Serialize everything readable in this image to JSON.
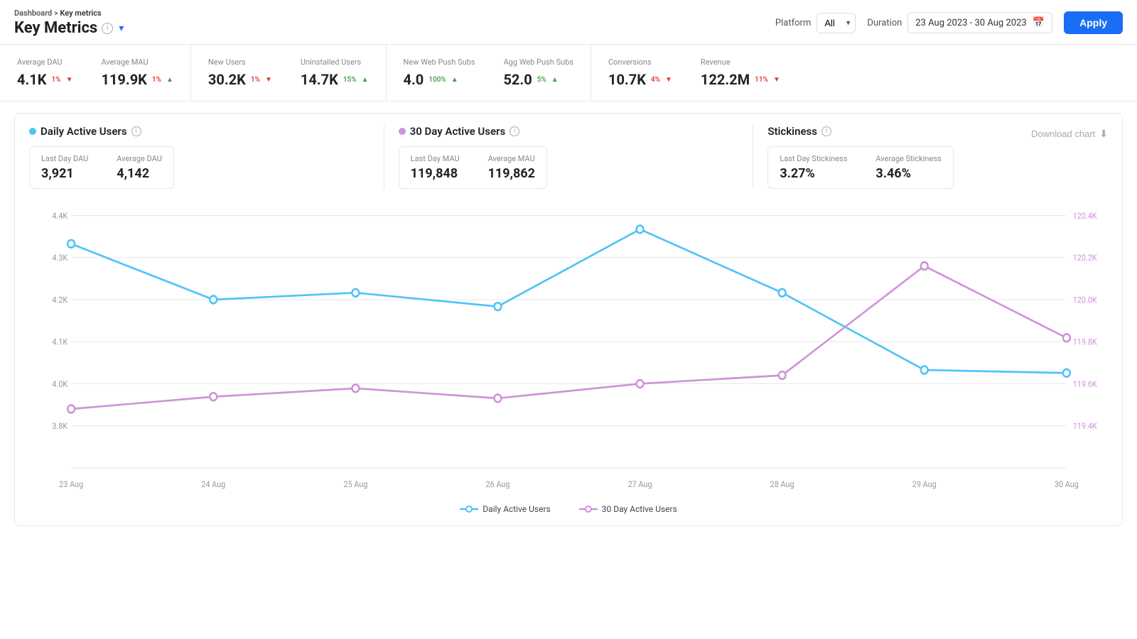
{
  "breadcrumb": {
    "parent": "Dashboard",
    "separator": " > ",
    "current": "Key metrics"
  },
  "page": {
    "title": "Key Metrics"
  },
  "controls": {
    "platform_label": "Platform",
    "platform_value": "All",
    "duration_label": "Duration",
    "date_range": "23 Aug 2023 - 30 Aug 2023",
    "apply_label": "Apply"
  },
  "metrics": [
    {
      "label": "Average DAU",
      "value": "4.1K",
      "pct": "1%",
      "direction": "down"
    },
    {
      "label": "Average MAU",
      "value": "119.9K",
      "pct": "1%",
      "direction": "up"
    },
    {
      "label": "New Users",
      "value": "30.2K",
      "pct": "1%",
      "direction": "down"
    },
    {
      "label": "Uninstalled Users",
      "value": "14.7K",
      "pct": "15%",
      "direction": "up"
    },
    {
      "label": "New Web Push Subs",
      "value": "4.0",
      "pct": "100%",
      "direction": "up"
    },
    {
      "label": "Agg Web Push Subs",
      "value": "52.0",
      "pct": "5%",
      "direction": "up"
    },
    {
      "label": "Conversions",
      "value": "10.7K",
      "pct": "4%",
      "direction": "down"
    },
    {
      "label": "Revenue",
      "value": "122.2M",
      "pct": "11%",
      "direction": "down"
    }
  ],
  "dau_section": {
    "title": "Daily Active Users",
    "last_day_label": "Last Day DAU",
    "last_day_value": "3,921",
    "avg_label": "Average DAU",
    "avg_value": "4,142"
  },
  "mau_section": {
    "title": "30 Day Active Users",
    "last_day_label": "Last Day MAU",
    "last_day_value": "119,848",
    "avg_label": "Average MAU",
    "avg_value": "119,862"
  },
  "stickiness_section": {
    "title": "Stickiness",
    "last_day_label": "Last Day Stickiness",
    "last_day_value": "3.27%",
    "avg_label": "Average Stickiness",
    "avg_value": "3.46%"
  },
  "download": {
    "label": "Download chart"
  },
  "chart": {
    "left_axis": [
      "4.4K",
      "4.3K",
      "4.2K",
      "4.1K",
      "4.0K",
      "3.8K"
    ],
    "right_axis": [
      "120.4K",
      "120.2K",
      "120.0K",
      "119.8K",
      "119.6K",
      "119.4K"
    ],
    "x_labels": [
      "23 Aug",
      "24 Aug",
      "25 Aug",
      "26 Aug",
      "27 Aug",
      "28 Aug",
      "29 Aug",
      "30 Aug"
    ],
    "dau_data": [
      4320,
      4160,
      4180,
      4140,
      4360,
      4180,
      3960,
      3950
    ],
    "mau_data": [
      119480,
      119540,
      119580,
      119530,
      119600,
      119640,
      120160,
      119820
    ],
    "legend_dau": "Daily Active Users",
    "legend_mau": "30 Day Active Users"
  }
}
